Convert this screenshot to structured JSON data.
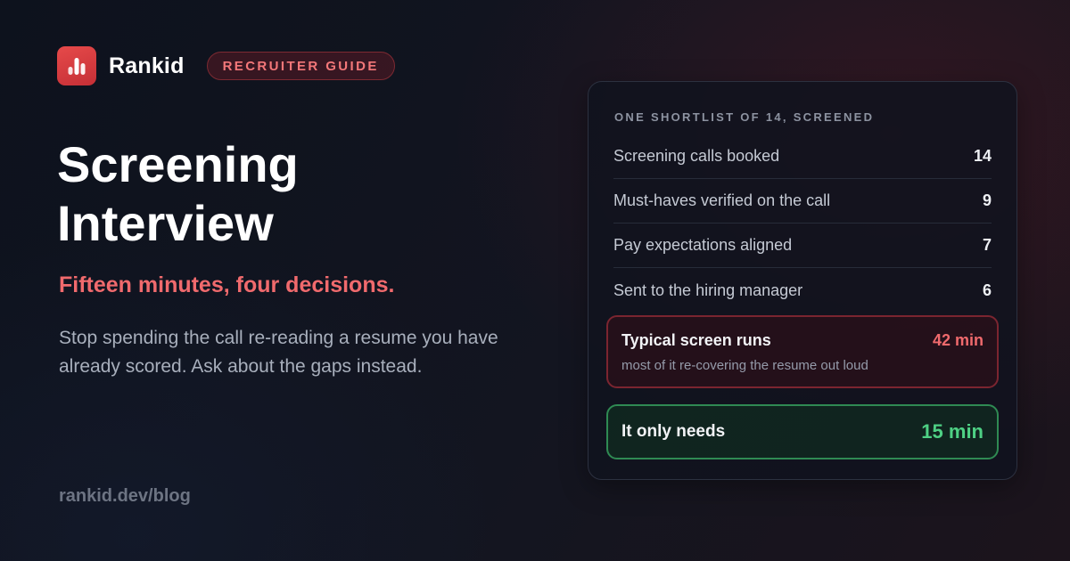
{
  "brand": {
    "name": "Rankid",
    "badge": "RECRUITER GUIDE",
    "icon": "bar-chart-logo-icon",
    "accent": "#e0393e"
  },
  "hero": {
    "title": "Screening Interview",
    "subtitle": "Fifteen minutes, four decisions.",
    "description": "Stop spending the call re-reading a resume you have already scored. Ask about the gaps instead."
  },
  "footer": {
    "url": "rankid.dev/blog"
  },
  "card": {
    "title": "ONE SHORTLIST OF 14, SCREENED",
    "rows": [
      {
        "label": "Screening calls booked",
        "value": "14"
      },
      {
        "label": "Must-haves verified on the call",
        "value": "9"
      },
      {
        "label": "Pay expectations aligned",
        "value": "7"
      },
      {
        "label": "Sent to the hiring manager",
        "value": "6"
      }
    ],
    "typical": {
      "label": "Typical screen runs",
      "value": "42 min",
      "note": "most of it re-covering the resume out loud",
      "color": "#f06a6d"
    },
    "needs": {
      "label": "It only needs",
      "value": "15 min",
      "color": "#4ed084"
    }
  }
}
